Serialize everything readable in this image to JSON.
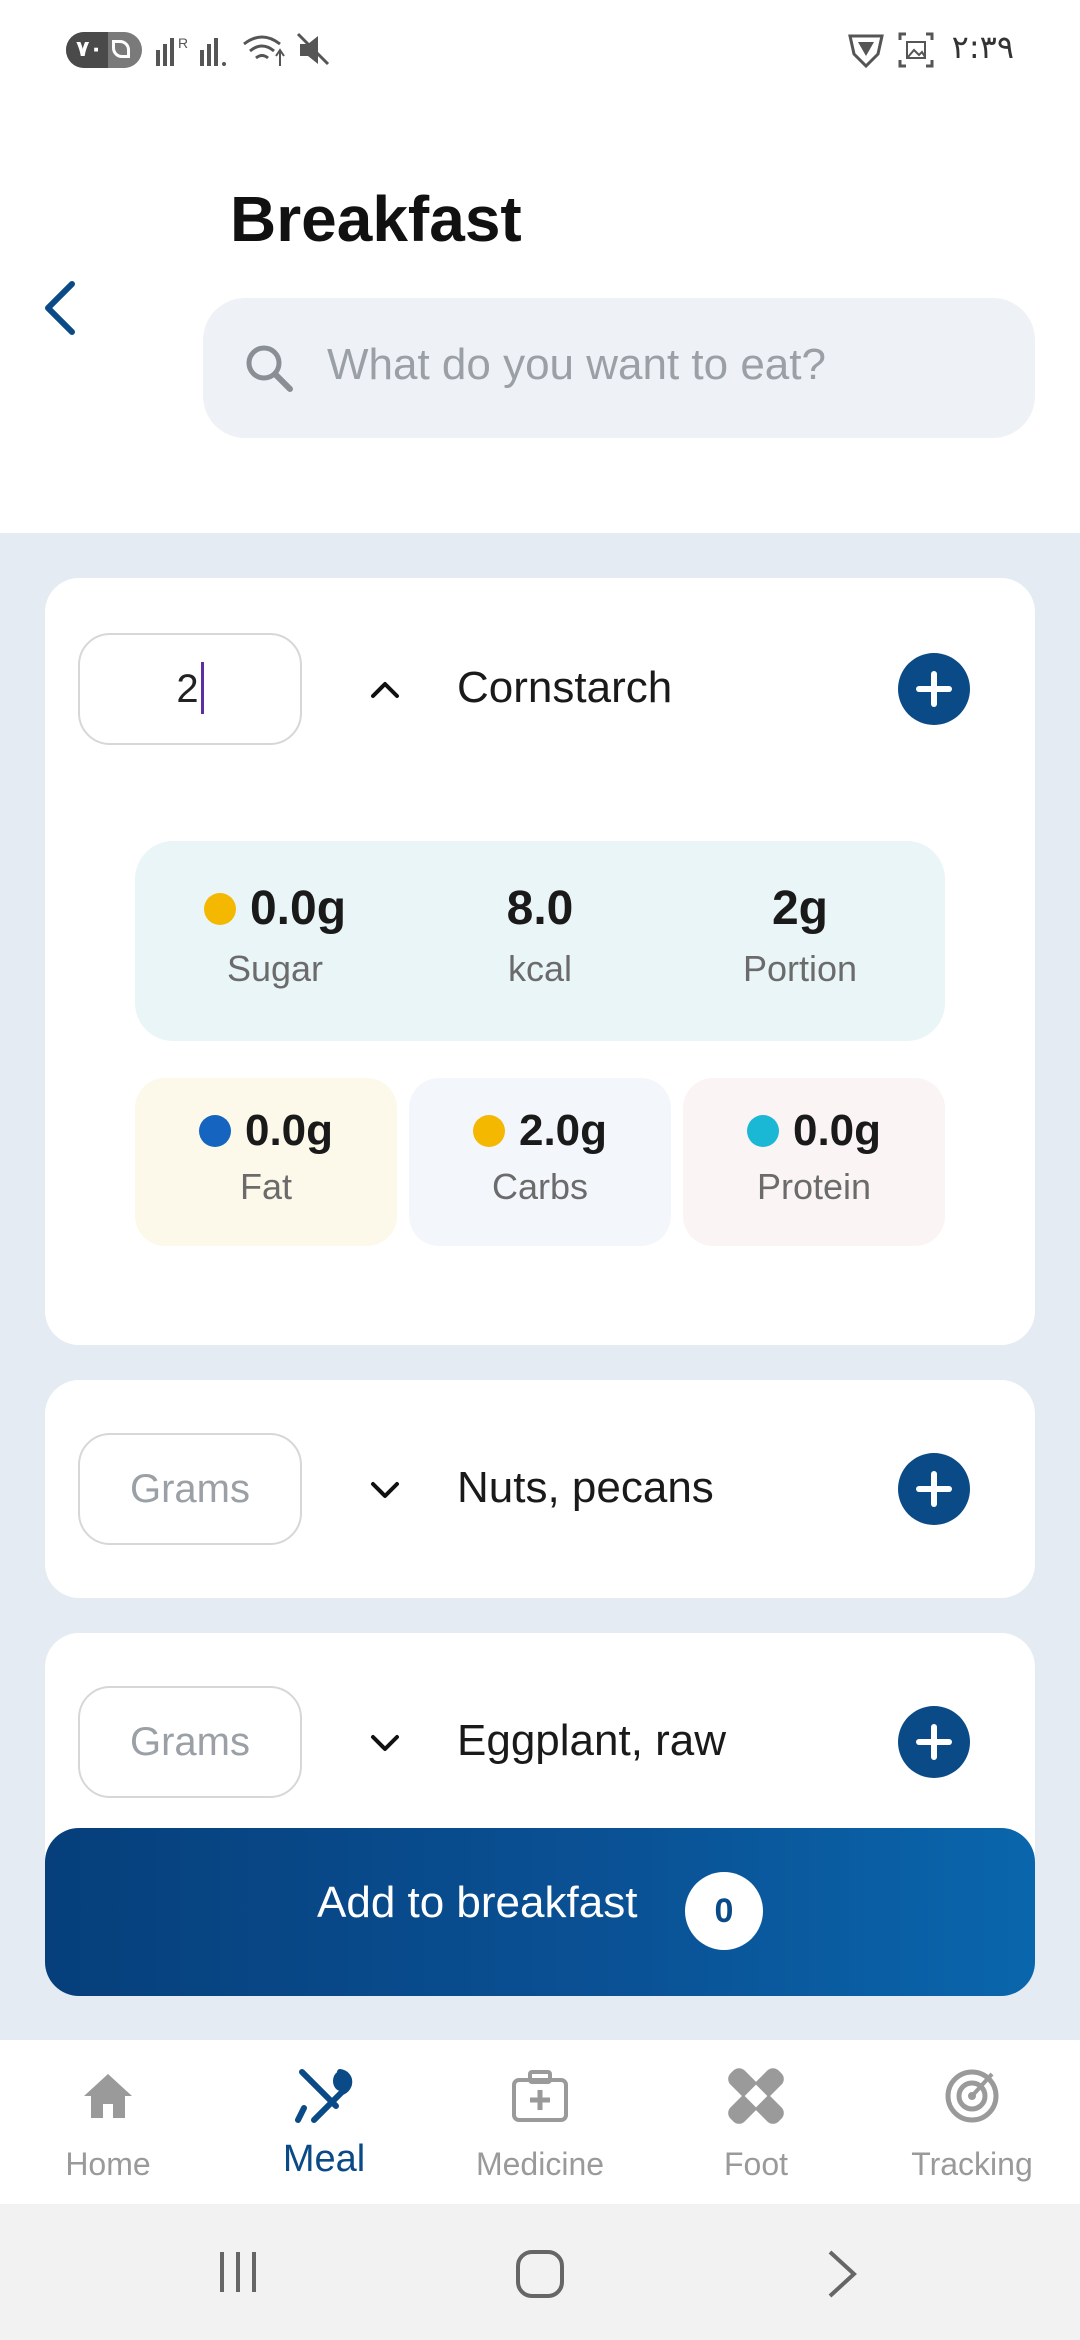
{
  "status_bar": {
    "battery": "٧٠",
    "time": "٢:٣٩",
    "network": "R"
  },
  "header": {
    "title": "Breakfast",
    "search_placeholder": "What do you want to eat?"
  },
  "foods": [
    {
      "name": "Cornstarch",
      "grams_value": "2",
      "expanded": true,
      "summary": {
        "sugar_value": "0.0g",
        "sugar_label": "Sugar",
        "kcal_value": "8.0",
        "kcal_label": "kcal",
        "portion_value": "2g",
        "portion_label": "Portion"
      },
      "macros": {
        "fat_value": "0.0g",
        "fat_label": "Fat",
        "carbs_value": "2.0g",
        "carbs_label": "Carbs",
        "protein_value": "0.0g",
        "protein_label": "Protein"
      }
    },
    {
      "name": "Nuts, pecans",
      "grams_placeholder": "Grams",
      "expanded": false
    },
    {
      "name": "Eggplant, raw",
      "grams_placeholder": "Grams",
      "expanded": false
    }
  ],
  "add_button": {
    "label": "Add to breakfast",
    "count": "0"
  },
  "bottom_nav": [
    {
      "label": "Home",
      "icon": "home-icon",
      "active": false
    },
    {
      "label": "Meal",
      "icon": "utensils-icon",
      "active": true
    },
    {
      "label": "Medicine",
      "icon": "medicine-kit-icon",
      "active": false
    },
    {
      "label": "Foot",
      "icon": "bandage-icon",
      "active": false
    },
    {
      "label": "Tracking",
      "icon": "target-icon",
      "active": false
    }
  ],
  "colors": {
    "primary": "#0a4a87",
    "sugar_dot": "#f5b800",
    "fat_dot": "#1565c0",
    "carbs_dot": "#f5b800",
    "protein_dot": "#1ab8d4",
    "summary_bg": "#eaf5f8",
    "fat_bg": "#fdf9ea",
    "carbs_bg": "#f3f7fc",
    "protein_bg": "#fbf4f4",
    "list_bg": "#e4ebf3"
  }
}
